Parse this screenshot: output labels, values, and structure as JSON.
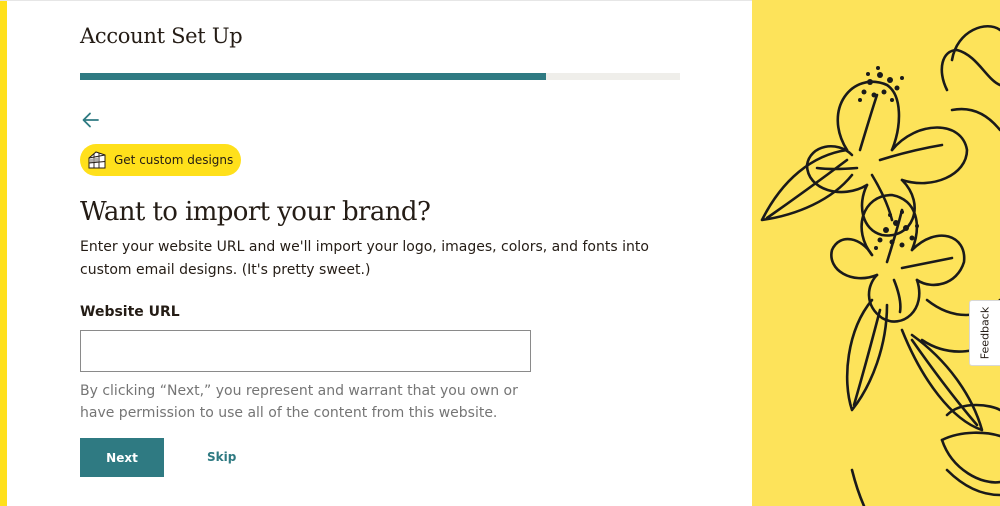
{
  "header": {
    "title": "Account Set Up"
  },
  "progress": {
    "fraction": 0.777,
    "color": "#2f7a82",
    "track_color": "#efeeea"
  },
  "nav": {
    "back_icon": "arrow-left-icon"
  },
  "pill": {
    "icon": "design-grid-icon",
    "label": "Get custom designs",
    "color": "#ffe01b"
  },
  "main": {
    "heading": "Want to import your brand?",
    "description": "Enter your website URL and we'll import your logo, images, colors, and fonts into custom email designs. (It's pretty sweet.)"
  },
  "form": {
    "url_label": "Website URL",
    "url_value": "",
    "url_placeholder": "",
    "disclaimer": "By clicking “Next,” you represent and warrant that you own or have permission to use all of the content from this website."
  },
  "actions": {
    "next_label": "Next",
    "skip_label": "Skip"
  },
  "feedback": {
    "label": "Feedback"
  },
  "colors": {
    "accent": "#2f7a82",
    "brand_yellow": "#ffe01b",
    "art_background": "#fde35a"
  }
}
